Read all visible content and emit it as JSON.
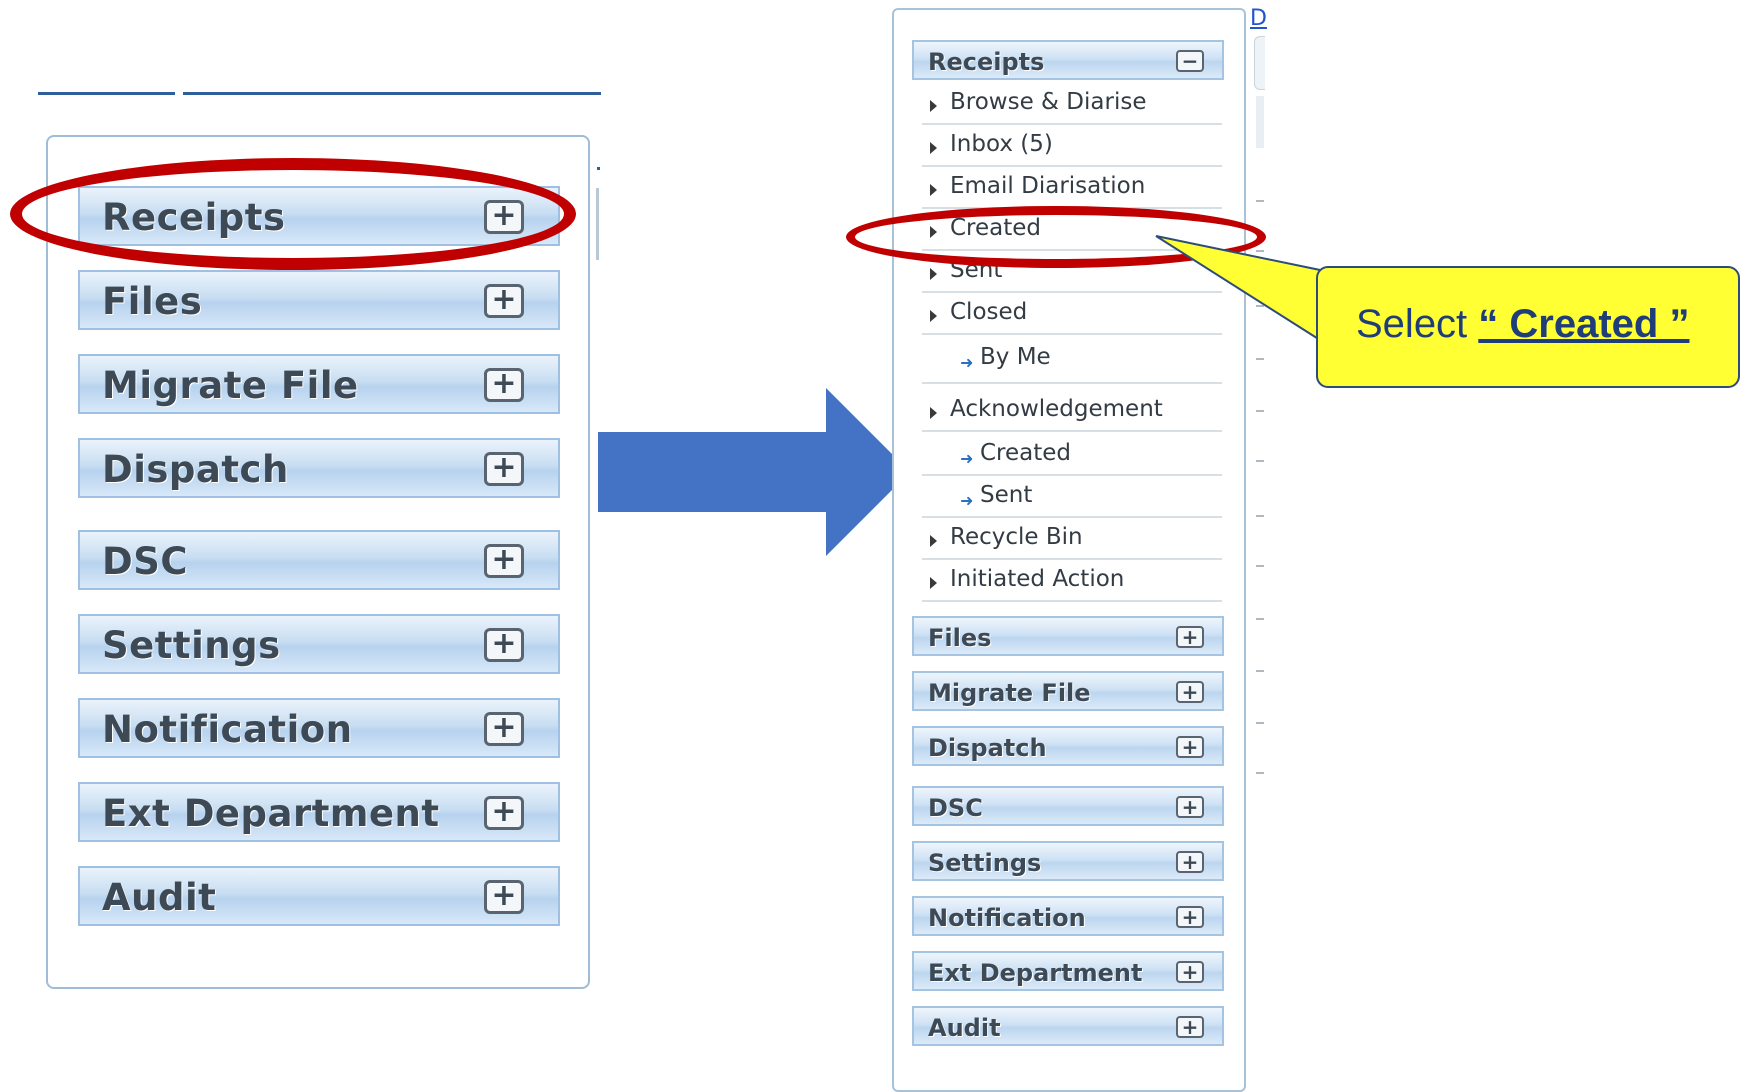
{
  "left_menu": {
    "headers": [
      {
        "label": "Receipts",
        "toggle": "+"
      },
      {
        "label": "Files",
        "toggle": "+"
      },
      {
        "label": "Migrate File",
        "toggle": "+"
      },
      {
        "label": "Dispatch",
        "toggle": "+"
      },
      {
        "label": "DSC",
        "toggle": "+"
      },
      {
        "label": "Settings",
        "toggle": "+"
      },
      {
        "label": "Notification",
        "toggle": "+"
      },
      {
        "label": "Ext Department",
        "toggle": "+"
      },
      {
        "label": "Audit",
        "toggle": "+"
      }
    ]
  },
  "right_menu": {
    "link_text": "D",
    "receipts": {
      "label": "Receipts",
      "toggle": "−"
    },
    "receipt_items": [
      {
        "label": "Browse & Diarise"
      },
      {
        "label": "Inbox (5)"
      },
      {
        "label": "Email Diarisation"
      },
      {
        "label": "Created"
      },
      {
        "label": "Sent"
      },
      {
        "label": "Closed"
      },
      {
        "label": "By Me",
        "child": true
      },
      {
        "label": "Acknowledgement"
      },
      {
        "label": "Created",
        "child": true
      },
      {
        "label": "Sent",
        "child": true
      },
      {
        "label": "Recycle Bin"
      },
      {
        "label": "Initiated Action"
      }
    ],
    "headers": [
      {
        "label": "Files",
        "toggle": "+"
      },
      {
        "label": "Migrate File",
        "toggle": "+"
      },
      {
        "label": "Dispatch",
        "toggle": "+"
      },
      {
        "label": "DSC",
        "toggle": "+"
      },
      {
        "label": "Settings",
        "toggle": "+"
      },
      {
        "label": "Notification",
        "toggle": "+"
      },
      {
        "label": "Ext Department",
        "toggle": "+"
      },
      {
        "label": "Audit",
        "toggle": "+"
      }
    ]
  },
  "callout": {
    "prefix": "Select ",
    "emphasis": "“ Created ”"
  },
  "colors": {
    "highlight_ring": "#c00000",
    "arrow": "#4472c4",
    "callout_fill": "#ffff33",
    "callout_text": "#1f3d78"
  }
}
